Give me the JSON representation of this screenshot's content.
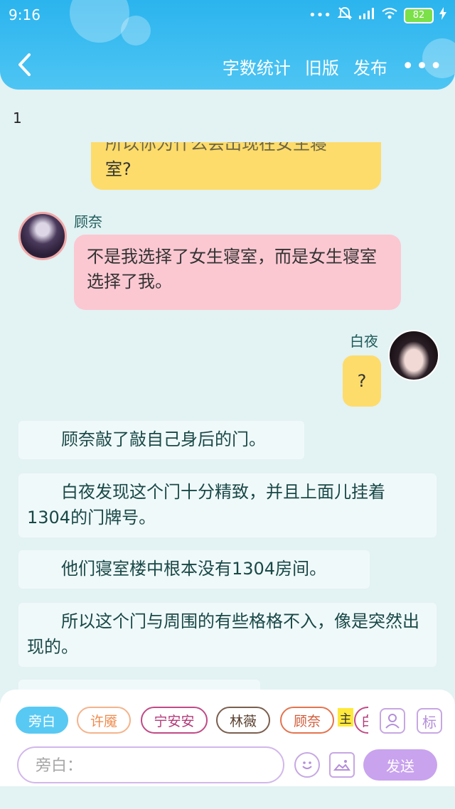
{
  "status": {
    "time": "9:16",
    "battery": "82"
  },
  "header": {
    "actions": [
      "字数统计",
      "旧版",
      "发布"
    ],
    "more": "•••"
  },
  "page_number": "1",
  "messages": {
    "partial_top_line": "所以你为什么会出现在女生寝",
    "partial_bottom_line": "室?",
    "gunai": {
      "sender": "顾奈",
      "text": "不是我选择了女生寝室，而是女生寝室选择了我。"
    },
    "baiye": {
      "sender": "白夜",
      "text": "?"
    }
  },
  "narrations": [
    "顾奈敲了敲自己身后的门。",
    "白夜发现这个门十分精致，并且上面儿挂着1304的门牌号。",
    "他们寝室楼中根本没有1304房间。",
    "所以这个门与周围的有些格格不入，像是突然出现的。"
  ],
  "roles": [
    "旁白",
    "许魇",
    "宁安安",
    "林薇",
    "顾奈",
    "白"
  ],
  "main_tag": "主",
  "role_icon_label": "",
  "tag_icon_label": "标",
  "input": {
    "placeholder": "旁白："
  },
  "send_label": "发送"
}
